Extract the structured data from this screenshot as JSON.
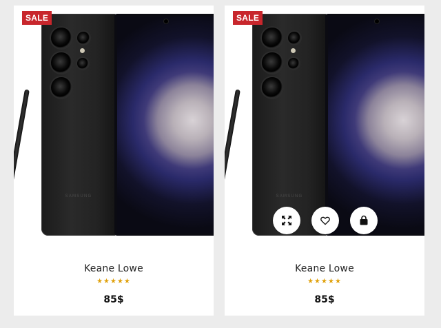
{
  "colors": {
    "sale_badge": "#c8262c",
    "star": "#e0a10b",
    "background": "#ececec"
  },
  "products": [
    {
      "badge": "SALE",
      "name": "Keane Lowe",
      "rating": 5,
      "stars_text": "★★★★★",
      "price": "85$",
      "phone_brand": "SAMSUNG",
      "hover_actions_visible": false
    },
    {
      "badge": "SALE",
      "name": "Keane Lowe",
      "rating": 5,
      "stars_text": "★★★★★",
      "price": "85$",
      "phone_brand": "SAMSUNG",
      "hover_actions_visible": true,
      "actions": [
        "quick-view-icon",
        "heart-icon",
        "shopping-bag-icon"
      ]
    }
  ]
}
